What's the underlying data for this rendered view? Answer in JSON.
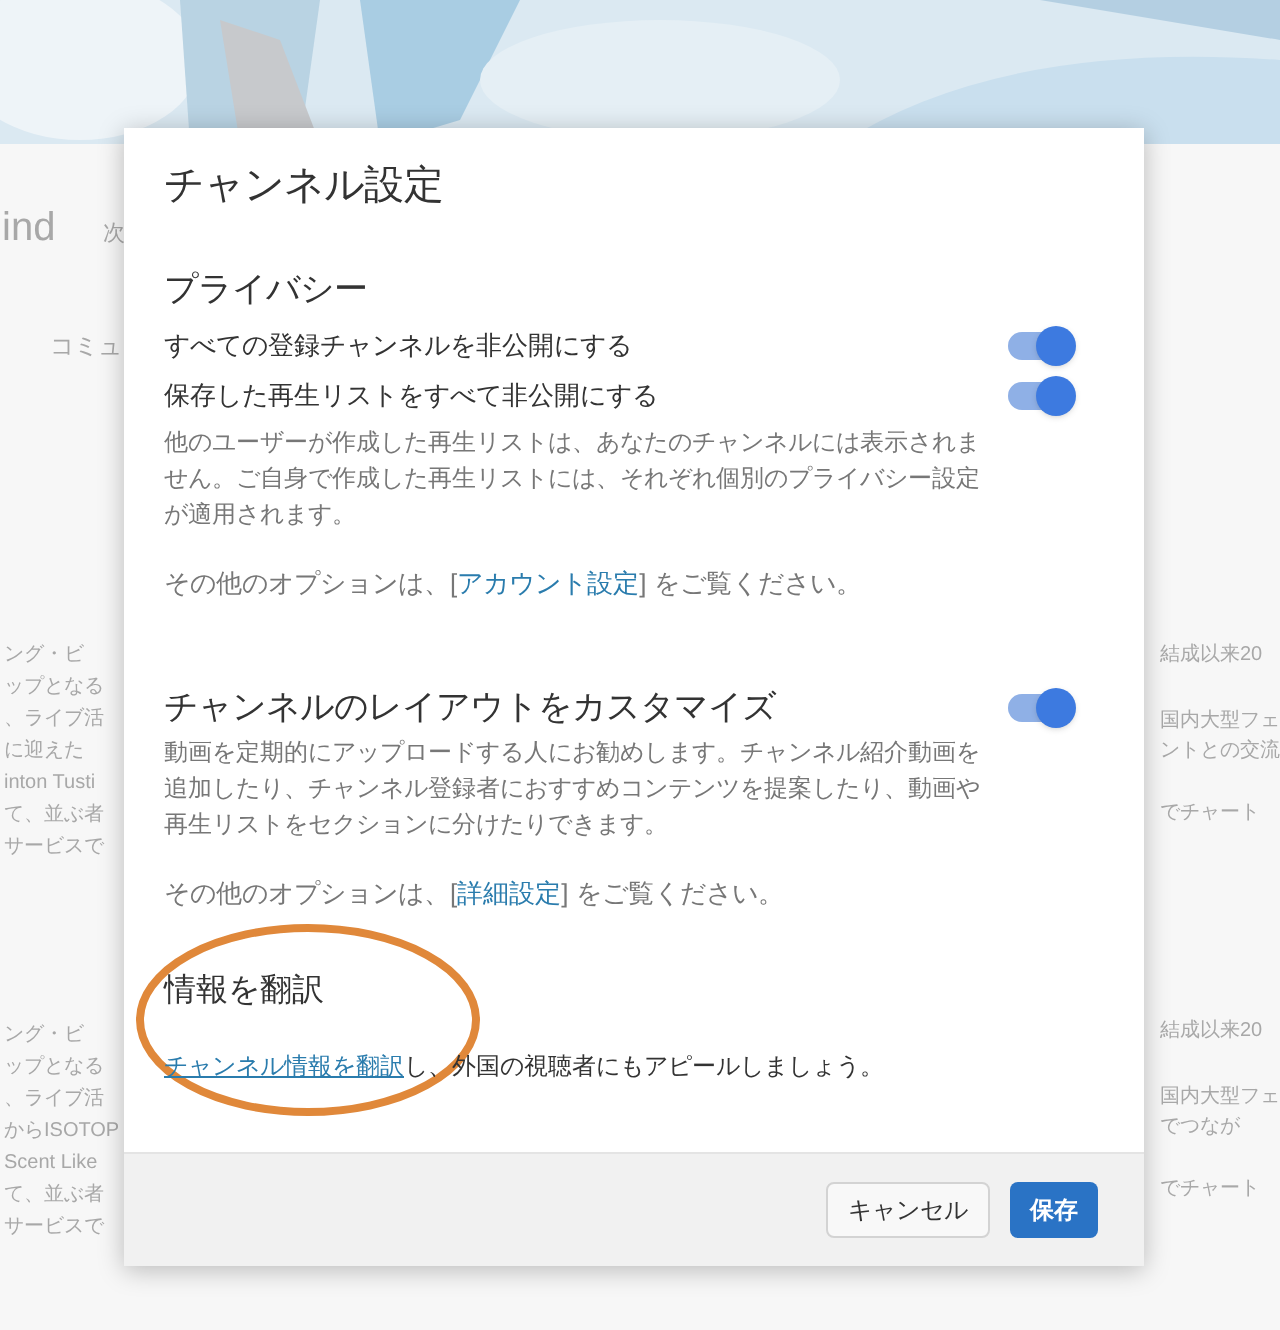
{
  "background": {
    "channel_name": "ind",
    "subtitle": "次",
    "tab": "コミュ",
    "left_groups": [
      [
        "ング・ビ",
        "ップとなる",
        "、ライブ活",
        "に迎えた",
        "inton Tusti",
        "て、並ぶ者",
        "サービスで"
      ],
      [
        "ング・ビ",
        "ップとなる",
        "、ライブ活",
        "からISOTOP",
        "Scent Like",
        "て、並ぶ者",
        "サービスで"
      ]
    ],
    "right_groups": [
      [
        "結成以来20",
        "国内大型フェ",
        "ントとの交流",
        "でチャート"
      ],
      [
        "結成以来20",
        "国内大型フェ",
        "でつなが",
        "でチャート"
      ]
    ]
  },
  "dialog": {
    "title": "チャンネル設定",
    "sections": [
      {
        "kind": "toggles",
        "heading": "プライバシー",
        "toggles": [
          {
            "label": "すべての登録チャンネルを非公開にする",
            "on": true
          },
          {
            "label": "保存した再生リストをすべて非公開にする",
            "on": true
          }
        ],
        "description": "他のユーザーが作成した再生リストは、あなたのチャンネルには表示されません。ご自身で作成した再生リストには、それぞれ個別のプライバシー設定が適用されます。",
        "more": {
          "before": "その他のオプションは、[",
          "link": "アカウント設定",
          "after": "] をご覧ください。"
        }
      },
      {
        "kind": "heading_toggle",
        "heading": "チャンネルのレイアウトをカスタマイズ",
        "on": true,
        "description": "動画を定期的にアップロードする人にお勧めします。チャンネル紹介動画を追加したり、チャンネル登録者におすすめコンテンツを提案したり、動画や再生リストをセクションに分けたりできます。",
        "more": {
          "before": "その他のオプションは、[",
          "link": "詳細設定",
          "after": "] をご覧ください。"
        }
      },
      {
        "kind": "link_text",
        "heading": "情報を翻訳",
        "link": "チャンネル情報を翻訳",
        "text": "し、外国の視聴者にもアピールしましょう。"
      }
    ],
    "buttons": [
      {
        "label": "キャンセル",
        "kind": "secondary"
      },
      {
        "label": "保存",
        "kind": "primary"
      }
    ]
  }
}
